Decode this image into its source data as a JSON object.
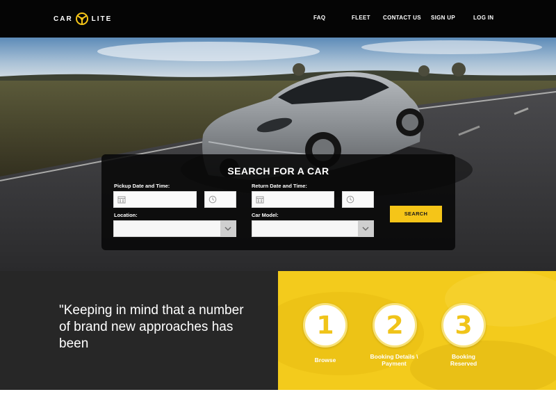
{
  "brand": {
    "left": "CAR",
    "right": "LITE",
    "accent": "#f5c518",
    "logo_icon": "steering-wheel-icon"
  },
  "nav": {
    "items": [
      "FAQ",
      "FLEET",
      "CONTACT US",
      "SIGN UP",
      "LOG IN"
    ]
  },
  "search": {
    "title": "SEARCH FOR A CAR",
    "pickup_label": "Pickup Date and Time:",
    "return_label": "Return Date and Time:",
    "location_label": "Location:",
    "car_model_label": "Car Model:",
    "button_label": "SEARCH",
    "pickup_date_value": "",
    "pickup_time_value": "",
    "return_date_value": "",
    "return_time_value": "",
    "location_value": "",
    "car_model_value": "",
    "icons": {
      "date": "calendar-icon",
      "time": "clock-icon",
      "dropdown": "chevron-down-icon"
    }
  },
  "quote": {
    "text": "\"Keeping in mind that a number of brand new approaches has been"
  },
  "steps": [
    {
      "number": "1",
      "label": "Browse"
    },
    {
      "number": "2",
      "label": "Booking Details \\ Payment"
    },
    {
      "number": "3",
      "label": "Booking Reserved"
    }
  ],
  "colors": {
    "nav_bg": "#050505",
    "quote_bg": "#272727",
    "steps_bg": "#f3cb1c",
    "step_number": "#f0c41a"
  }
}
